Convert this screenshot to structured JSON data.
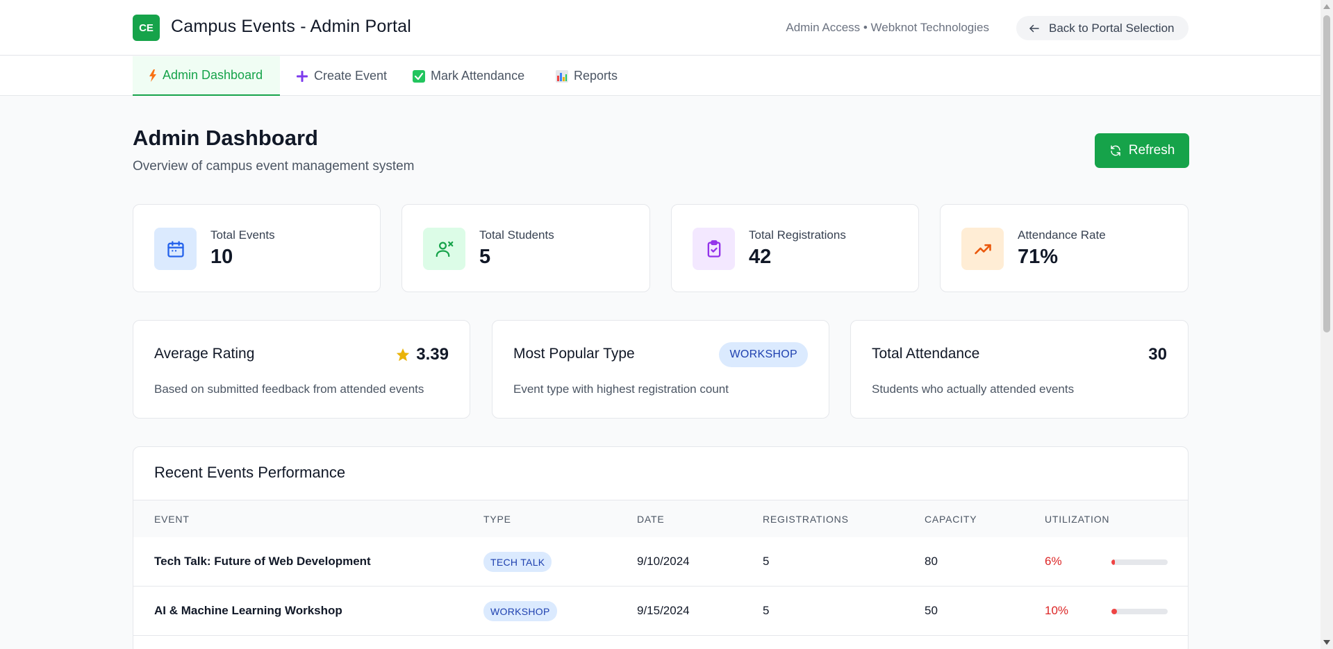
{
  "header": {
    "logo_text": "CE",
    "title": "Campus Events - Admin Portal",
    "org_info": "Admin Access • Webknot Technologies",
    "back_label": "Back to Portal Selection"
  },
  "tabs": [
    {
      "label": "Admin Dashboard",
      "icon": "lightning-icon",
      "active": true
    },
    {
      "label": "Create Event",
      "icon": "plus-icon",
      "active": false
    },
    {
      "label": "Mark Attendance",
      "icon": "checkbox-icon",
      "active": false
    },
    {
      "label": "Reports",
      "icon": "bar-chart-icon",
      "active": false
    }
  ],
  "page": {
    "title": "Admin Dashboard",
    "subtitle": "Overview of campus event management system",
    "refresh_label": "Refresh"
  },
  "stats": [
    {
      "label": "Total Events",
      "value": "10",
      "icon": "calendar-icon",
      "color": "#2563eb",
      "bg": "#dbeafe"
    },
    {
      "label": "Total Students",
      "value": "5",
      "icon": "users-icon",
      "color": "#16a34a",
      "bg": "#dcfce7"
    },
    {
      "label": "Total Registrations",
      "value": "42",
      "icon": "clipboard-check-icon",
      "color": "#9333ea",
      "bg": "#f3e8ff"
    },
    {
      "label": "Attendance Rate",
      "value": "71%",
      "icon": "trending-up-icon",
      "color": "#ea580c",
      "bg": "#ffedd5"
    }
  ],
  "info": {
    "rating": {
      "title": "Average Rating",
      "value": "3.39",
      "desc": "Based on submitted feedback from attended events",
      "icon": "star-icon",
      "color": "#eab308"
    },
    "popular": {
      "title": "Most Popular Type",
      "value": "WORKSHOP",
      "desc": "Event type with highest registration count"
    },
    "attendance": {
      "title": "Total Attendance",
      "value": "30",
      "desc": "Students who actually attended events"
    }
  },
  "table": {
    "title": "Recent Events Performance",
    "headers": [
      "EVENT",
      "TYPE",
      "DATE",
      "REGISTRATIONS",
      "CAPACITY",
      "UTILIZATION"
    ],
    "rows": [
      {
        "event": "Tech Talk: Future of Web Development",
        "type": "TECH TALK",
        "date": "9/10/2024",
        "registrations": "5",
        "capacity": "80",
        "utilization": "6%",
        "utilization_pct": 6
      },
      {
        "event": "AI & Machine Learning Workshop",
        "type": "WORKSHOP",
        "date": "9/15/2024",
        "registrations": "5",
        "capacity": "50",
        "utilization": "10%",
        "utilization_pct": 10
      }
    ]
  },
  "colors": {
    "accent": "#16a34a",
    "danger": "#dc2626",
    "pill_bg": "#dbeafe",
    "pill_text": "#1e40af"
  }
}
